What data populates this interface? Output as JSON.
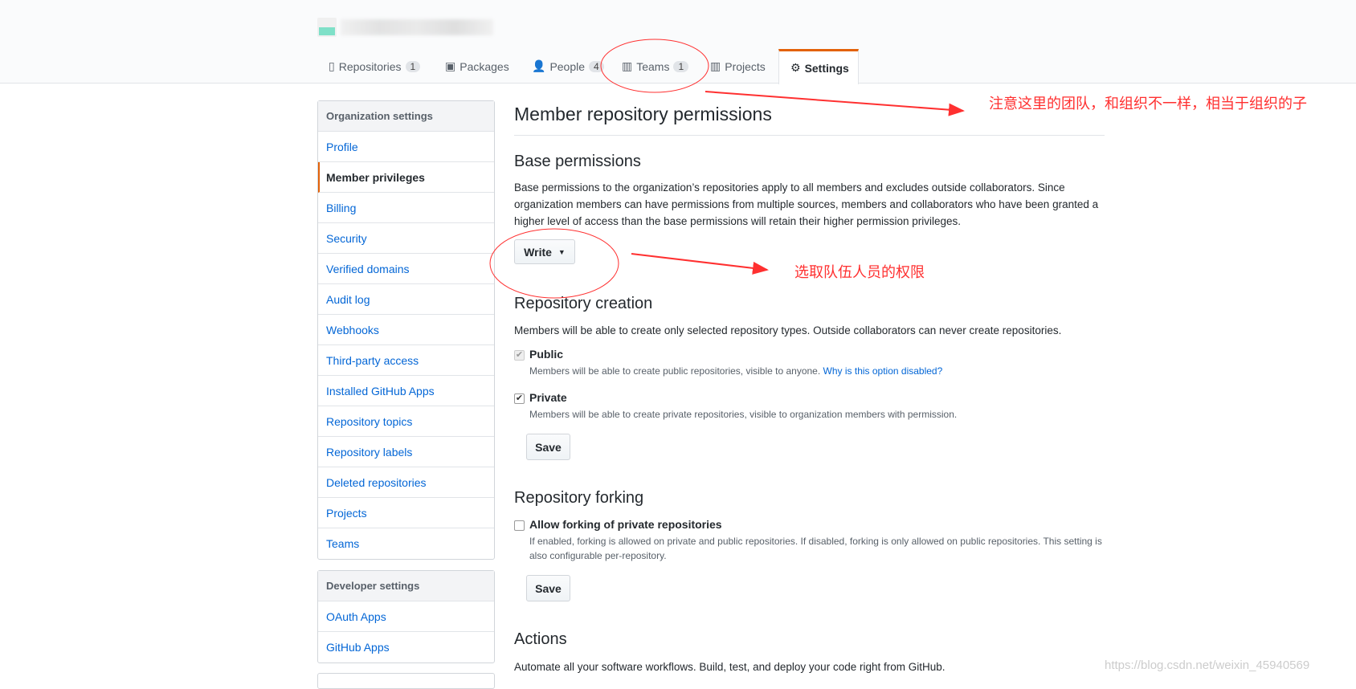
{
  "header": {
    "tabs": [
      {
        "label": "Repositories",
        "count": "1",
        "icon": "repo-icon"
      },
      {
        "label": "Packages",
        "icon": "package-icon"
      },
      {
        "label": "People",
        "count": "4",
        "icon": "person-icon"
      },
      {
        "label": "Teams",
        "count": "1",
        "icon": "jersey-icon"
      },
      {
        "label": "Projects",
        "icon": "project-icon"
      },
      {
        "label": "Settings",
        "icon": "gear-icon",
        "selected": true
      }
    ]
  },
  "sidebar": {
    "org_title": "Organization settings",
    "org_items": [
      "Profile",
      "Member privileges",
      "Billing",
      "Security",
      "Verified domains",
      "Audit log",
      "Webhooks",
      "Third-party access",
      "Installed GitHub Apps",
      "Repository topics",
      "Repository labels",
      "Deleted repositories",
      "Projects",
      "Teams"
    ],
    "selected": "Member privileges",
    "dev_title": "Developer settings",
    "dev_items": [
      "OAuth Apps",
      "GitHub Apps"
    ]
  },
  "main": {
    "title": "Member repository permissions",
    "base": {
      "heading": "Base permissions",
      "desc": "Base permissions to the organization’s repositories apply to all members and excludes outside collaborators. Since organization members can have permissions from multiple sources, members and collaborators who have been granted a higher level of access than the base permissions will retain their higher permission privileges.",
      "value": "Write"
    },
    "creation": {
      "heading": "Repository creation",
      "desc": "Members will be able to create only selected repository types. Outside collaborators can never create repositories.",
      "public_label": "Public",
      "public_checked": true,
      "public_disabled": true,
      "public_note": "Members will be able to create public repositories, visible to anyone.",
      "public_link": "Why is this option disabled?",
      "private_label": "Private",
      "private_checked": true,
      "private_note": "Members will be able to create private repositories, visible to organization members with permission.",
      "save": "Save"
    },
    "forking": {
      "heading": "Repository forking",
      "label": "Allow forking of private repositories",
      "checked": false,
      "note": "If enabled, forking is allowed on private and public repositories. If disabled, forking is only allowed on public repositories. This setting is also configurable per-repository.",
      "save": "Save"
    },
    "actions": {
      "heading": "Actions",
      "desc": "Automate all your software workflows. Build, test, and deploy your code right from GitHub."
    }
  },
  "annotations": {
    "teams_note": "注意这里的团队，和组织不一样，相当于组织的子",
    "write_note": "选取队伍人员的权限",
    "color": "#ff3030"
  },
  "watermark": "https://blog.csdn.net/weixin_45940569"
}
